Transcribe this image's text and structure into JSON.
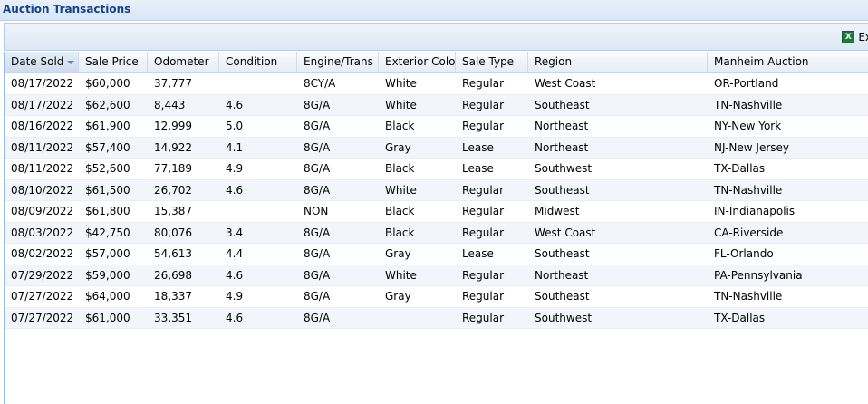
{
  "panel": {
    "title": "Auction Transactions"
  },
  "toolbar": {
    "export_label": "Ex",
    "export_icon": "excel-icon"
  },
  "grid": {
    "sorted_column": "Date Sold",
    "sort_direction": "descending",
    "columns": [
      "Date Sold",
      "Sale Price",
      "Odometer",
      "Condition",
      "Engine/Trans",
      "Exterior Color",
      "Sale Type",
      "Region",
      "Manheim Auction"
    ],
    "rows": [
      [
        "08/17/2022",
        "$60,000",
        "37,777",
        "",
        "8CY/A",
        "White",
        "Regular",
        "West Coast",
        "OR-Portland"
      ],
      [
        "08/17/2022",
        "$62,600",
        "8,443",
        "4.6",
        "8G/A",
        "White",
        "Regular",
        "Southeast",
        "TN-Nashville"
      ],
      [
        "08/16/2022",
        "$61,900",
        "12,999",
        "5.0",
        "8G/A",
        "Black",
        "Regular",
        "Northeast",
        "NY-New York"
      ],
      [
        "08/11/2022",
        "$57,400",
        "14,922",
        "4.1",
        "8G/A",
        "Gray",
        "Lease",
        "Northeast",
        "NJ-New Jersey"
      ],
      [
        "08/11/2022",
        "$52,600",
        "77,189",
        "4.9",
        "8G/A",
        "Black",
        "Lease",
        "Southwest",
        "TX-Dallas"
      ],
      [
        "08/10/2022",
        "$61,500",
        "26,702",
        "4.6",
        "8G/A",
        "White",
        "Regular",
        "Southeast",
        "TN-Nashville"
      ],
      [
        "08/09/2022",
        "$61,800",
        "15,387",
        "",
        "NON",
        "Black",
        "Regular",
        "Midwest",
        "IN-Indianapolis"
      ],
      [
        "08/03/2022",
        "$42,750",
        "80,076",
        "3.4",
        "8G/A",
        "Black",
        "Regular",
        "West Coast",
        "CA-Riverside"
      ],
      [
        "08/02/2022",
        "$57,000",
        "54,613",
        "4.4",
        "8G/A",
        "Gray",
        "Lease",
        "Southeast",
        "FL-Orlando"
      ],
      [
        "07/29/2022",
        "$59,000",
        "26,698",
        "4.6",
        "8G/A",
        "White",
        "Regular",
        "Northeast",
        "PA-Pennsylvania"
      ],
      [
        "07/27/2022",
        "$64,000",
        "18,337",
        "4.9",
        "8G/A",
        "Gray",
        "Regular",
        "Southeast",
        "TN-Nashville"
      ],
      [
        "07/27/2022",
        "$61,000",
        "33,351",
        "4.6",
        "8G/A",
        "",
        "Regular",
        "Southwest",
        "TX-Dallas"
      ]
    ]
  },
  "colors": {
    "title_text": "#15428b",
    "header_border": "#99bbe8",
    "row_alt": "#f2f6fb",
    "sort_arrow": "#5b86c4"
  }
}
